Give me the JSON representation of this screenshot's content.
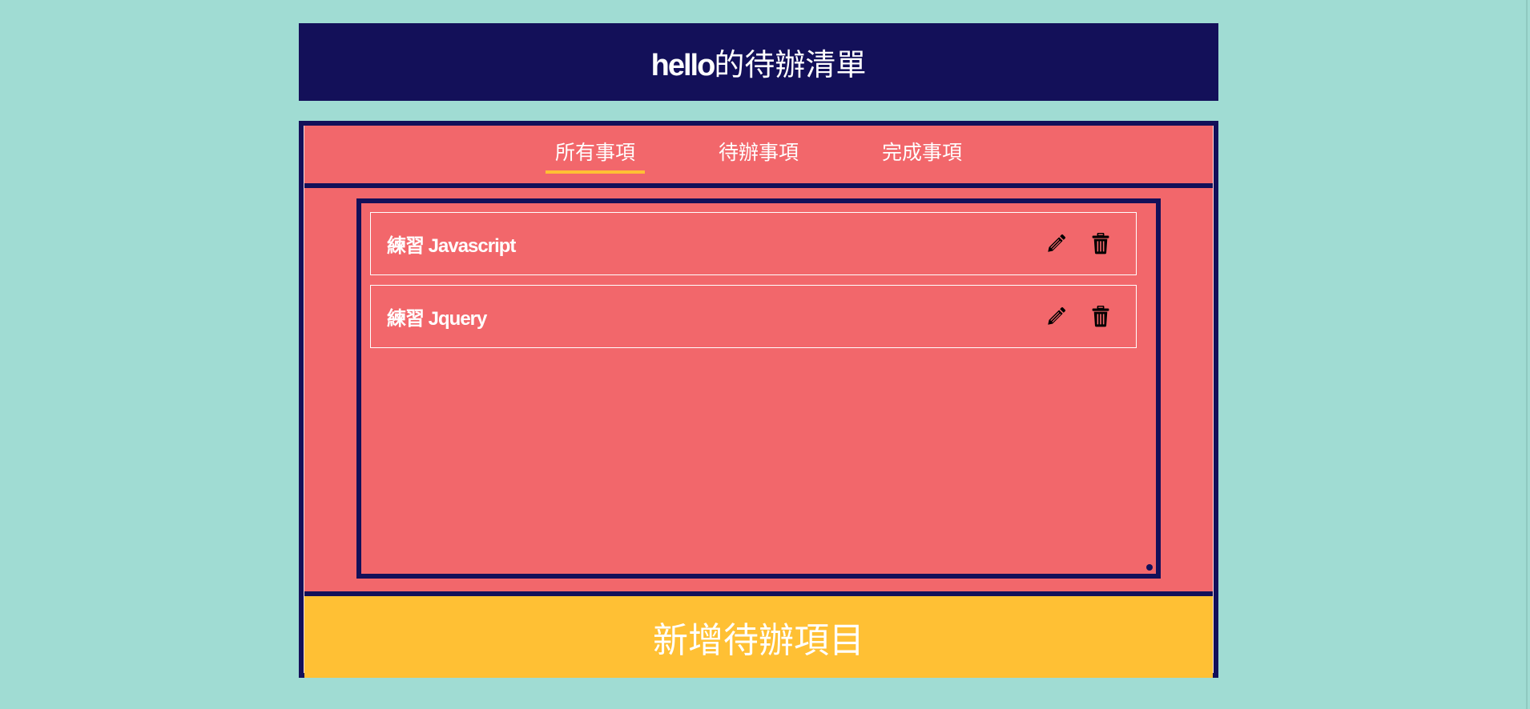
{
  "header": {
    "name": "hello",
    "title_suffix": "的待辦清單"
  },
  "tabs": [
    {
      "label": "所有事項",
      "active": true
    },
    {
      "label": "待辦事項",
      "active": false
    },
    {
      "label": "完成事項",
      "active": false
    }
  ],
  "todos": [
    {
      "label": "練習 Javascript",
      "edit_icon": "pencil-icon",
      "delete_icon": "trash-icon"
    },
    {
      "label": "練習 Jquery",
      "edit_icon": "pencil-icon",
      "delete_icon": "trash-icon"
    }
  ],
  "add_button": {
    "label": "新增待辦項目"
  },
  "colors": {
    "background": "#a0dcd3",
    "navy": "#131059",
    "coral": "#f2676b",
    "accent": "#ffc034",
    "text": "#ffffff"
  }
}
